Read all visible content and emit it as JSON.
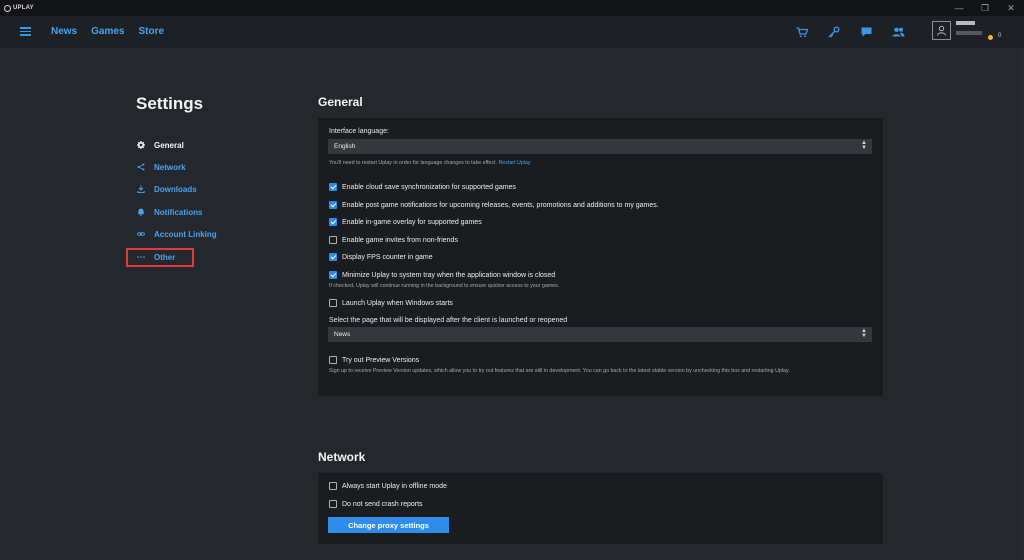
{
  "app": {
    "logo_text": "UPLAY"
  },
  "window_controls": [
    "—",
    "❐",
    "✕"
  ],
  "nav": {
    "links": [
      "News",
      "Games",
      "Store"
    ],
    "icons": [
      "cart-icon",
      "key-icon",
      "chat-icon",
      "friends-icon"
    ],
    "coin_value": "0"
  },
  "sidebar": {
    "title": "Settings",
    "items": [
      {
        "label": "General",
        "icon": "gear-icon",
        "active": true
      },
      {
        "label": "Network",
        "icon": "network-icon",
        "active": false
      },
      {
        "label": "Downloads",
        "icon": "download-icon",
        "active": false
      },
      {
        "label": "Notifications",
        "icon": "bell-icon",
        "active": false
      },
      {
        "label": "Account Linking",
        "icon": "link-icon",
        "active": false
      },
      {
        "label": "Other",
        "icon": "more-icon",
        "active": false
      }
    ]
  },
  "general": {
    "title": "General",
    "language_label": "Interface language:",
    "language_value": "English",
    "language_note": "You'll need to restart Uplay in order for language changes to take effect.",
    "restart_link": "Restart Uplay",
    "options": [
      {
        "label": "Enable cloud save synchronization for supported games",
        "checked": true
      },
      {
        "label": "Enable post game notifications for upcoming releases, events, promotions and additions to my games.",
        "checked": true
      },
      {
        "label": "Enable in-game overlay for supported games",
        "checked": true
      },
      {
        "label": "Enable game invites from non-friends",
        "checked": false
      },
      {
        "label": "Display FPS counter in game",
        "checked": true
      },
      {
        "label": "Minimize Uplay to system tray when the application window is closed",
        "checked": true
      },
      {
        "label": "Launch Uplay when Windows starts",
        "checked": false
      }
    ],
    "tray_note": "If checked, Uplay will continue running in the background to ensure quicker access to your games.",
    "startpage_label": "Select the page that will be displayed after the client is launched or reopened",
    "startpage_value": "News",
    "preview_label": "Try out Preview Versions",
    "preview_checked": false,
    "preview_note": "Sign up to receive Preview Version updates, which allow you to try out features that are still in development. You can go back to the latest stable version by unchecking this box and restarting Uplay."
  },
  "network": {
    "title": "Network",
    "options": [
      {
        "label": "Always start Uplay in offline mode",
        "checked": false
      },
      {
        "label": "Do not send crash reports",
        "checked": false
      }
    ],
    "proxy_button": "Change proxy settings"
  },
  "colors": {
    "accent": "#2f8ceb",
    "link": "#4aa2f0",
    "highlight": "#e23b3b"
  }
}
